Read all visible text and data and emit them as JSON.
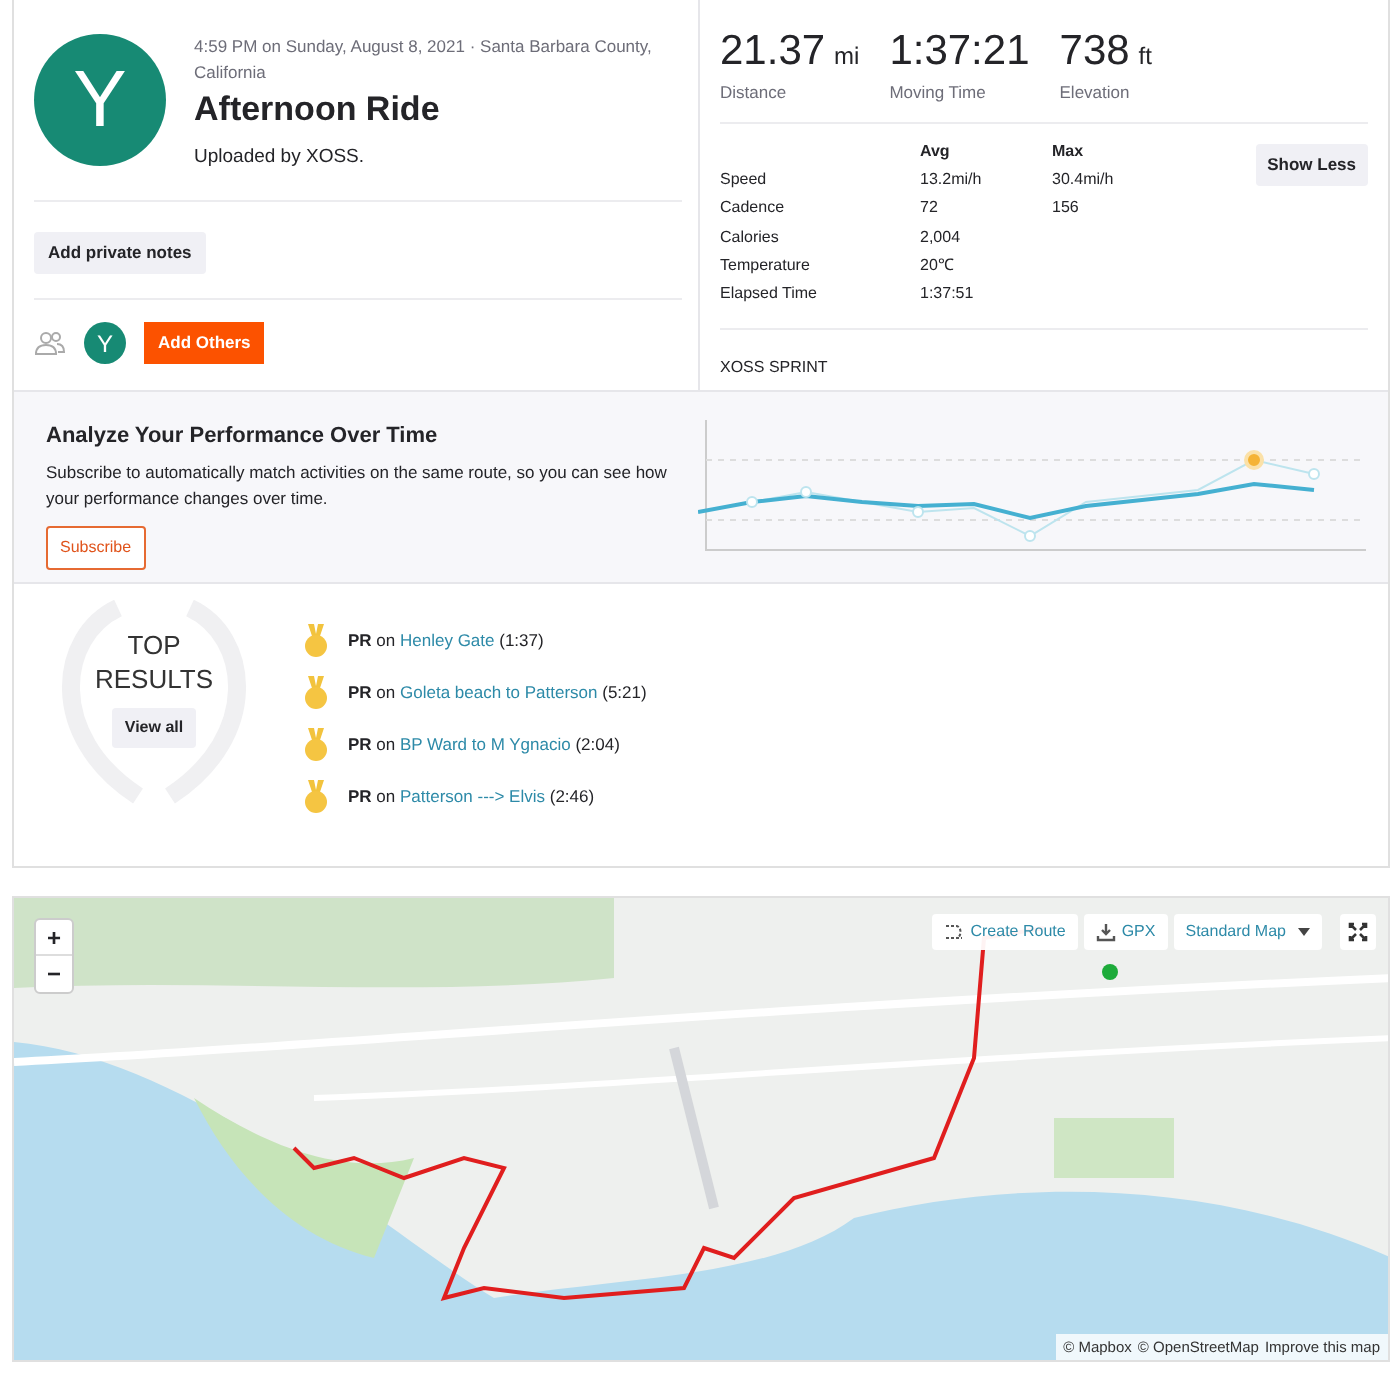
{
  "activity": {
    "avatar_letter": "Y",
    "meta": "4:59 PM on Sunday, August 8, 2021 · Santa Barbara County, California",
    "title": "Afternoon Ride",
    "uploaded_by": "Uploaded by XOSS."
  },
  "notes_button": "Add private notes",
  "participants": {
    "avatar_letter": "Y",
    "add_button": "Add Others"
  },
  "primary_stats": [
    {
      "value": "21.37",
      "unit": "mi",
      "label": "Distance"
    },
    {
      "value": "1:37:21",
      "label": "Moving Time"
    },
    {
      "value": "738",
      "unit": "ft",
      "label": "Elevation"
    }
  ],
  "stats_table": {
    "columns": [
      "Avg",
      "Max"
    ],
    "rows": [
      {
        "label": "Speed",
        "avg": "13.2mi/h",
        "max": "30.4mi/h"
      },
      {
        "label": "Cadence",
        "avg": "72",
        "max": "156"
      },
      {
        "label": "Calories",
        "avg": "2,004"
      },
      {
        "label": "Temperature",
        "avg": "20℃"
      },
      {
        "label": "Elapsed Time",
        "avg": "1:37:51"
      }
    ]
  },
  "toggle_button": "Show Less",
  "device": "XOSS SPRINT",
  "analyze": {
    "title": "Analyze Your Performance Over Time",
    "description": "Subscribe to automatically match activities on the same route, so you can see how your performance changes over time.",
    "button": "Subscribe"
  },
  "top_results": {
    "title": "TOP RESULTS",
    "button": "View all"
  },
  "achievements": [
    {
      "prefix": "**PR** on",
      "segment": "Henley Gate",
      "time": "(1:37)"
    },
    {
      "prefix": "**PR** on",
      "segment": "Goleta beach to Patterson",
      "time": "(5:21)"
    },
    {
      "prefix": "**PR** on",
      "segment": "BP Ward to M Ygnacio",
      "time": "(2:04)"
    },
    {
      "prefix": "**PR** on",
      "segment": "Patterson ---> Elvis",
      "time": "(2:46)"
    }
  ],
  "map": {
    "zoom_in": "+",
    "zoom_out": "−",
    "buttons": [
      "Create Route",
      "GPX"
    ],
    "style_select": "Standard Map",
    "attribution": [
      "© Mapbox",
      "© OpenStreetMap",
      "Improve this map"
    ]
  }
}
